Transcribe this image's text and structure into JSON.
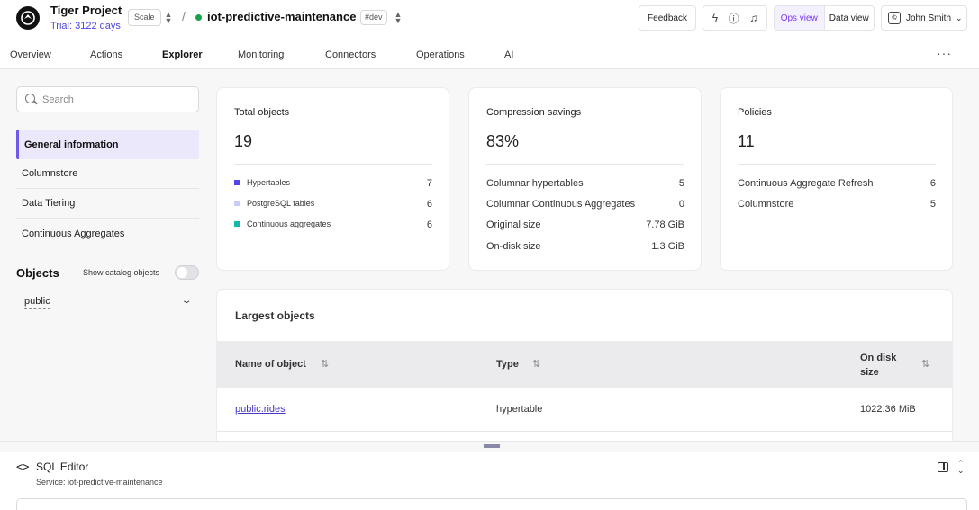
{
  "header": {
    "project_name": "Tiger Project",
    "trial_text": "Trial: 3122 days",
    "plan_badge": "Scale",
    "service_name": "iot-predictive-maintenance",
    "env_badge": "#dev",
    "feedback_label": "Feedback",
    "ops_view_label": "Ops view",
    "data_view_label": "Data view",
    "user_name": "John Smith",
    "status_color": "#16a34a",
    "accent_color": "#7c3aed"
  },
  "nav": {
    "tabs": [
      {
        "label": "Overview"
      },
      {
        "label": "Actions"
      },
      {
        "label": "Explorer"
      },
      {
        "label": "Monitoring"
      },
      {
        "label": "Connectors"
      },
      {
        "label": "Operations"
      },
      {
        "label": "AI"
      }
    ],
    "active_tab": "Explorer"
  },
  "sidebar": {
    "search_placeholder": "Search",
    "items": [
      {
        "label": "General information"
      },
      {
        "label": "Columnstore"
      },
      {
        "label": "Data Tiering"
      },
      {
        "label": "Continuous Aggregates"
      }
    ],
    "objects_title": "Objects",
    "catalog_toggle_label": "Show catalog objects",
    "schema_value": "public"
  },
  "cards": {
    "total": {
      "title": "Total objects",
      "value": "19",
      "rows": [
        {
          "label": "Hypertables",
          "value": "7",
          "color": "#4f46e5"
        },
        {
          "label": "PostgreSQL tables",
          "value": "6",
          "color": "#c7cbf5"
        },
        {
          "label": "Continuous aggregates",
          "value": "6",
          "color": "#14b8a6"
        }
      ]
    },
    "compression": {
      "title": "Compression savings",
      "value": "83%",
      "rows": [
        {
          "label": "Columnar hypertables",
          "value": "5"
        },
        {
          "label": "Columnar Continuous Aggregates",
          "value": "0"
        },
        {
          "label": "Original size",
          "value": "7.78 GiB"
        },
        {
          "label": "On-disk size",
          "value": "1.3 GiB"
        }
      ]
    },
    "policies": {
      "title": "Policies",
      "value": "11",
      "rows": [
        {
          "label": "Continuous Aggregate Refresh",
          "value": "6"
        },
        {
          "label": "Columnstore",
          "value": "5"
        }
      ]
    }
  },
  "largest_objects": {
    "title": "Largest objects",
    "columns": [
      "Name of object",
      "Type",
      "On disk size"
    ],
    "rows": [
      {
        "name": "public.rides",
        "type": "hypertable",
        "size": "1022.36 MiB"
      }
    ]
  },
  "sql_editor": {
    "title": "SQL Editor",
    "service_text": "Service: iot-predictive-maintenance"
  }
}
